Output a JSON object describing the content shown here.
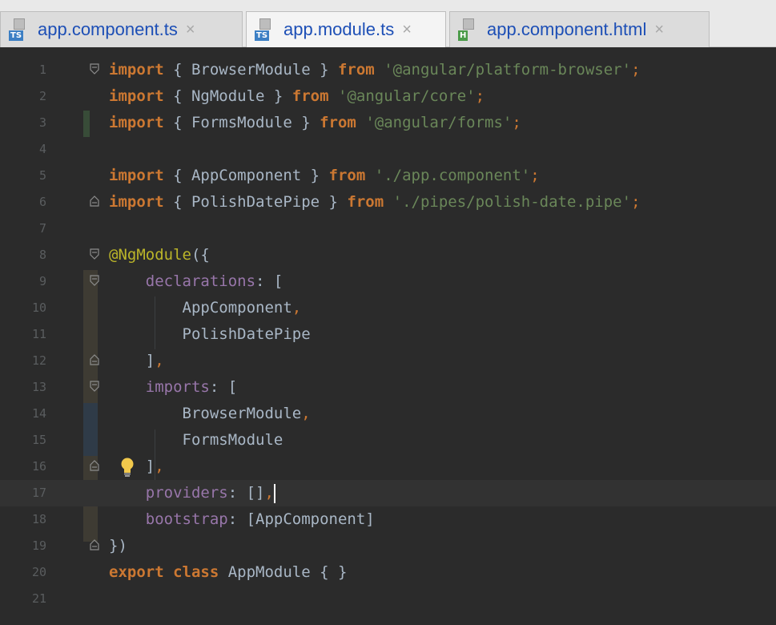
{
  "tabs": [
    {
      "label": "app.component.ts",
      "badge": "TS",
      "active": false
    },
    {
      "label": "app.module.ts",
      "badge": "TS",
      "active": true
    },
    {
      "label": "app.component.html",
      "badge": "H",
      "active": false
    }
  ],
  "close_glyph": "×",
  "icons": {
    "fold": "fold-marker-icon",
    "bulb": "lightbulb-icon",
    "file": "file-icon"
  },
  "colors": {
    "background": "#2b2b2b",
    "keyword": "#cc7832",
    "string": "#6a8759",
    "annotation": "#bbb529",
    "property": "#9876aa",
    "text": "#a9b7c6",
    "line_number": "#5a5d5f"
  },
  "editor": {
    "current_line": 17,
    "lines": [
      {
        "n": "1",
        "tokens": [
          [
            "kw",
            "import"
          ],
          [
            "default",
            " { BrowserModule } "
          ],
          [
            "kw",
            "from"
          ],
          [
            "default",
            " "
          ],
          [
            "str",
            "'@angular/platform-browser'"
          ],
          [
            "punc",
            ";"
          ]
        ]
      },
      {
        "n": "2",
        "tokens": [
          [
            "kw",
            "import"
          ],
          [
            "default",
            " { NgModule } "
          ],
          [
            "kw",
            "from"
          ],
          [
            "default",
            " "
          ],
          [
            "str",
            "'@angular/core'"
          ],
          [
            "punc",
            ";"
          ]
        ]
      },
      {
        "n": "3",
        "tokens": [
          [
            "kw",
            "import"
          ],
          [
            "default",
            " { FormsModule } "
          ],
          [
            "kw",
            "from"
          ],
          [
            "default",
            " "
          ],
          [
            "str",
            "'@angular/forms'"
          ],
          [
            "punc",
            ";"
          ]
        ]
      },
      {
        "n": "4",
        "tokens": []
      },
      {
        "n": "5",
        "tokens": [
          [
            "kw",
            "import"
          ],
          [
            "default",
            " { AppComponent } "
          ],
          [
            "kw",
            "from"
          ],
          [
            "default",
            " "
          ],
          [
            "str",
            "'./app.component'"
          ],
          [
            "punc",
            ";"
          ]
        ]
      },
      {
        "n": "6",
        "tokens": [
          [
            "kw",
            "import"
          ],
          [
            "default",
            " { PolishDatePipe } "
          ],
          [
            "kw",
            "from"
          ],
          [
            "default",
            " "
          ],
          [
            "str",
            "'./pipes/polish-date.pipe'"
          ],
          [
            "punc",
            ";"
          ]
        ]
      },
      {
        "n": "7",
        "tokens": []
      },
      {
        "n": "8",
        "tokens": [
          [
            "ann",
            "@NgModule"
          ],
          [
            "default",
            "({"
          ]
        ]
      },
      {
        "n": "9",
        "tokens": [
          [
            "default",
            "    "
          ],
          [
            "prop",
            "declarations"
          ],
          [
            "default",
            ": ["
          ]
        ]
      },
      {
        "n": "10",
        "tokens": [
          [
            "default",
            "        AppComponent"
          ],
          [
            "punc",
            ","
          ]
        ]
      },
      {
        "n": "11",
        "tokens": [
          [
            "default",
            "        PolishDatePipe"
          ]
        ]
      },
      {
        "n": "12",
        "tokens": [
          [
            "default",
            "    ]"
          ],
          [
            "punc",
            ","
          ]
        ]
      },
      {
        "n": "13",
        "tokens": [
          [
            "default",
            "    "
          ],
          [
            "prop",
            "imports"
          ],
          [
            "default",
            ": ["
          ]
        ]
      },
      {
        "n": "14",
        "tokens": [
          [
            "default",
            "        BrowserModule"
          ],
          [
            "punc",
            ","
          ]
        ]
      },
      {
        "n": "15",
        "tokens": [
          [
            "default",
            "        FormsModule"
          ]
        ]
      },
      {
        "n": "16",
        "tokens": [
          [
            "default",
            "    ]"
          ],
          [
            "punc",
            ","
          ]
        ]
      },
      {
        "n": "17",
        "tokens": [
          [
            "default",
            "    "
          ],
          [
            "prop",
            "providers"
          ],
          [
            "default",
            ": []"
          ],
          [
            "punc",
            ","
          ]
        ]
      },
      {
        "n": "18",
        "tokens": [
          [
            "default",
            "    "
          ],
          [
            "prop",
            "bootstrap"
          ],
          [
            "default",
            ": [AppComponent]"
          ]
        ]
      },
      {
        "n": "19",
        "tokens": [
          [
            "default",
            "})"
          ]
        ]
      },
      {
        "n": "20",
        "tokens": [
          [
            "kw",
            "export class"
          ],
          [
            "default",
            " AppModule { }"
          ]
        ]
      },
      {
        "n": "21",
        "tokens": []
      }
    ]
  }
}
